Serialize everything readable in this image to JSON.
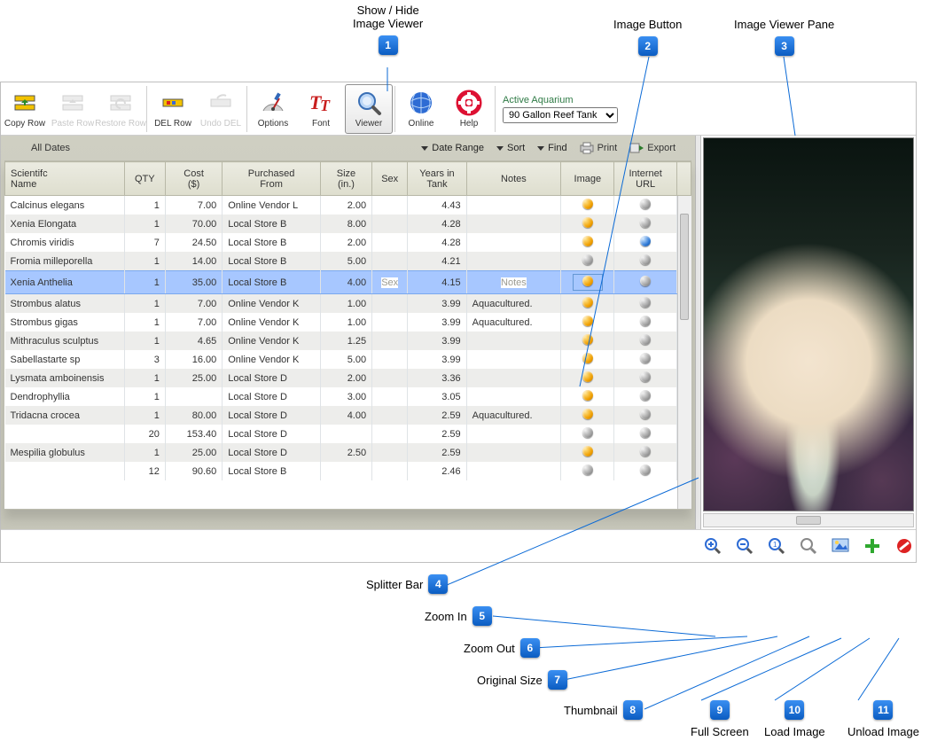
{
  "callouts": {
    "c1": {
      "num": "1",
      "label": "Show / Hide\nImage Viewer"
    },
    "c2": {
      "num": "2",
      "label": "Image Button"
    },
    "c3": {
      "num": "3",
      "label": "Image Viewer Pane"
    },
    "c4": {
      "num": "4",
      "label": "Splitter Bar"
    },
    "c5": {
      "num": "5",
      "label": "Zoom In"
    },
    "c6": {
      "num": "6",
      "label": "Zoom Out"
    },
    "c7": {
      "num": "7",
      "label": "Original Size"
    },
    "c8": {
      "num": "8",
      "label": "Thumbnail"
    },
    "c9": {
      "num": "9",
      "label": "Full Screen"
    },
    "c10": {
      "num": "10",
      "label": "Load Image"
    },
    "c11": {
      "num": "11",
      "label": "Unload Image"
    }
  },
  "toolbar": {
    "copy": "Copy Row",
    "paste": "Paste Row",
    "restore": "Restore Row",
    "del": "DEL Row",
    "undo": "Undo DEL",
    "options": "Options",
    "font": "Font",
    "viewer": "Viewer",
    "online": "Online",
    "help": "Help"
  },
  "active_aquarium": {
    "caption": "Active Aquarium",
    "value": "90 Gallon Reef Tank"
  },
  "filter": {
    "all_dates": "All Dates",
    "date_range": "Date Range",
    "sort": "Sort",
    "find": "Find",
    "print": "Print",
    "export": "Export"
  },
  "columns": {
    "scientific": "Scientifc\nName",
    "qty": "QTY",
    "cost": "Cost\n($)",
    "purchased": "Purchased\nFrom",
    "size": "Size\n(in.)",
    "sex": "Sex",
    "years": "Years in\nTank",
    "notes": "Notes",
    "image": "Image",
    "url": "Internet\nURL"
  },
  "placeholders": {
    "sex": "Sex",
    "notes": "Notes"
  },
  "img_toolbar": {
    "zoom_in": "Zoom In",
    "zoom_out": "Zoom Out",
    "original": "Original Size",
    "thumb": "Thumbnail",
    "full": "Full Screen",
    "load": "Load Image",
    "unload": "Unload Image"
  },
  "rows": [
    {
      "sci": "Calcinus elegans",
      "qty": "1",
      "cost": "7.00",
      "from": "Online Vendor L",
      "size": "2.00",
      "sex": "",
      "years": "4.43",
      "notes": "",
      "img": "orange",
      "url": "grey"
    },
    {
      "sci": "Xenia Elongata",
      "qty": "1",
      "cost": "70.00",
      "from": "Local Store B",
      "size": "8.00",
      "sex": "",
      "years": "4.28",
      "notes": "",
      "img": "orange",
      "url": "grey"
    },
    {
      "sci": "Chromis viridis",
      "qty": "7",
      "cost": "24.50",
      "from": "Local Store B",
      "size": "2.00",
      "sex": "",
      "years": "4.28",
      "notes": "",
      "img": "orange",
      "url": "blue"
    },
    {
      "sci": "Fromia milleporella",
      "qty": "1",
      "cost": "14.00",
      "from": "Local Store B",
      "size": "5.00",
      "sex": "",
      "years": "4.21",
      "notes": "",
      "img": "grey",
      "url": "grey"
    },
    {
      "sci": "Xenia Anthelia",
      "qty": "1",
      "cost": "35.00",
      "from": "Local Store B",
      "size": "4.00",
      "sex": "",
      "years": "4.15",
      "notes": "",
      "img": "orange",
      "url": "grey",
      "selected": true
    },
    {
      "sci": "Strombus alatus",
      "qty": "1",
      "cost": "7.00",
      "from": "Online Vendor K",
      "size": "1.00",
      "sex": "",
      "years": "3.99",
      "notes": "Aquacultured.",
      "img": "orange",
      "url": "grey"
    },
    {
      "sci": "Strombus gigas",
      "qty": "1",
      "cost": "7.00",
      "from": "Online Vendor K",
      "size": "1.00",
      "sex": "",
      "years": "3.99",
      "notes": "Aquacultured.",
      "img": "orange",
      "url": "grey"
    },
    {
      "sci": "Mithraculus sculptus",
      "qty": "1",
      "cost": "4.65",
      "from": "Online Vendor K",
      "size": "1.25",
      "sex": "",
      "years": "3.99",
      "notes": "",
      "img": "orange",
      "url": "grey"
    },
    {
      "sci": "Sabellastarte sp",
      "qty": "3",
      "cost": "16.00",
      "from": "Online Vendor K",
      "size": "5.00",
      "sex": "",
      "years": "3.99",
      "notes": "",
      "img": "orange",
      "url": "grey"
    },
    {
      "sci": "Lysmata amboinensis",
      "qty": "1",
      "cost": "25.00",
      "from": "Local Store D",
      "size": "2.00",
      "sex": "",
      "years": "3.36",
      "notes": "",
      "img": "orange",
      "url": "grey"
    },
    {
      "sci": "Dendrophyllia",
      "qty": "1",
      "cost": "",
      "from": "Local Store D",
      "size": "3.00",
      "sex": "",
      "years": "3.05",
      "notes": "",
      "img": "orange",
      "url": "grey"
    },
    {
      "sci": "Tridacna crocea",
      "qty": "1",
      "cost": "80.00",
      "from": "Local Store D",
      "size": "4.00",
      "sex": "",
      "years": "2.59",
      "notes": "Aquacultured.",
      "img": "orange",
      "url": "grey"
    },
    {
      "sci": "",
      "qty": "20",
      "cost": "153.40",
      "from": "Local Store D",
      "size": "",
      "sex": "",
      "years": "2.59",
      "notes": "",
      "img": "grey",
      "url": "grey"
    },
    {
      "sci": "Mespilia globulus",
      "qty": "1",
      "cost": "25.00",
      "from": "Local Store D",
      "size": "2.50",
      "sex": "",
      "years": "2.59",
      "notes": "",
      "img": "orange",
      "url": "grey"
    },
    {
      "sci": "",
      "qty": "12",
      "cost": "90.60",
      "from": "Local Store B",
      "size": "",
      "sex": "",
      "years": "2.46",
      "notes": "",
      "img": "grey",
      "url": "grey"
    }
  ]
}
